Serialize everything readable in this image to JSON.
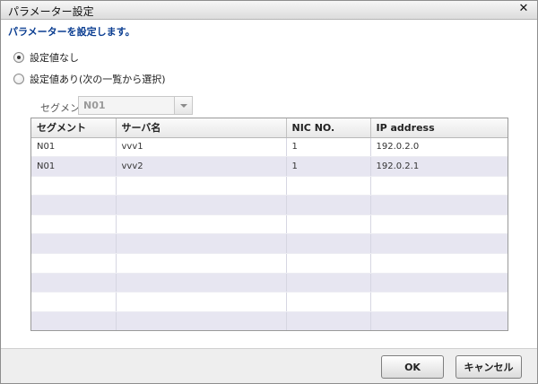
{
  "window": {
    "title": "パラメーター設定",
    "close_glyph": "✕"
  },
  "subtitle": "パラメーターを設定します。",
  "options": [
    {
      "label": "設定値なし",
      "checked": true
    },
    {
      "label": "設定値あり(次の一覧から選択)",
      "checked": false
    }
  ],
  "segment": {
    "label": "セグメント:",
    "value": "N01"
  },
  "table": {
    "columns": [
      "セグメント",
      "サーバ名",
      "NIC NO.",
      "IP address"
    ],
    "rows": [
      [
        "N01",
        "vvv1",
        "1",
        "192.0.2.0"
      ],
      [
        "N01",
        "vvv2",
        "1",
        "192.0.2.1"
      ],
      [
        "",
        "",
        "",
        ""
      ],
      [
        "",
        "",
        "",
        ""
      ],
      [
        "",
        "",
        "",
        ""
      ],
      [
        "",
        "",
        "",
        ""
      ],
      [
        "",
        "",
        "",
        ""
      ],
      [
        "",
        "",
        "",
        ""
      ],
      [
        "",
        "",
        "",
        ""
      ],
      [
        "",
        "",
        "",
        ""
      ]
    ]
  },
  "buttons": {
    "ok": "OK",
    "cancel": "キャンセル"
  }
}
